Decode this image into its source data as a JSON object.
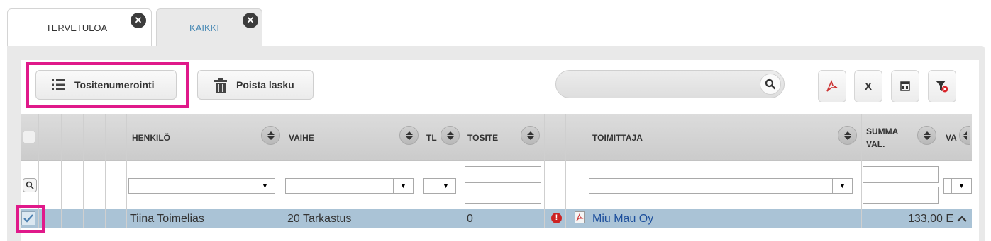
{
  "tabs": [
    {
      "label": "TERVETULOA",
      "close": "✕"
    },
    {
      "label": "KAIKKI",
      "close": "✕"
    }
  ],
  "toolbar": {
    "numbering_label": "Tositenumerointi",
    "delete_label": "Poista lasku",
    "search_value": "",
    "tools": [
      "pdf-export-icon",
      "excel-export-icon",
      "columns-icon",
      "clear-filter-icon"
    ],
    "export_excel_glyph": "X"
  },
  "columns": {
    "henkilo": "HENKILÖ",
    "vaihe": "VAIHE",
    "tl": "TL",
    "tosite": "TOSITE",
    "toimittaja": "TOIMITTAJA",
    "summa_line1": "SUMMA",
    "summa_line2": "VAL.",
    "va": "VA"
  },
  "rows": [
    {
      "selected": true,
      "henkilo": "Tiina Toimelias",
      "vaihe": "20 Tarkastus",
      "tosite": "0",
      "warning": "!",
      "toimittaja": "Miu Mau Oy",
      "summa": "133,00 E"
    }
  ],
  "colors": {
    "highlight": "#e0198a",
    "row_selected": "#aac3d6",
    "link": "#1d4f9c"
  }
}
